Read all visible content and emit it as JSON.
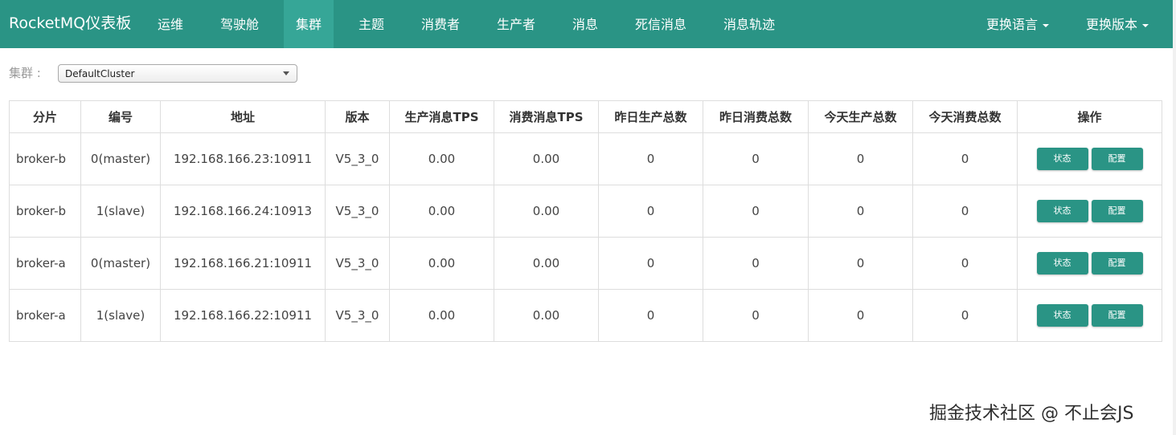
{
  "navbar": {
    "brand": "RocketMQ仪表板",
    "items": [
      "运维",
      "驾驶舱",
      "集群",
      "主题",
      "消费者",
      "生产者",
      "消息",
      "死信消息",
      "消息轨迹"
    ],
    "active": "集群",
    "language": "更换语言",
    "version": "更换版本",
    "color": "#2a9485"
  },
  "cluster": {
    "label": "集群 :",
    "selected": "DefaultCluster"
  },
  "table": {
    "headers": [
      "分片",
      "编号",
      "地址",
      "版本",
      "生产消息TPS",
      "消费消息TPS",
      "昨日生产总数",
      "昨日消费总数",
      "今天生产总数",
      "今天消费总数",
      "操作"
    ],
    "rows": [
      {
        "name": "broker-b",
        "id": "0(master)",
        "addr": "192.168.166.23:10911",
        "version": "V5_3_0",
        "in_tps": "0.00",
        "out_tps": "0.00",
        "yest_in": "0",
        "yest_out": "0",
        "today_in": "0",
        "today_out": "0"
      },
      {
        "name": "broker-b",
        "id": "1(slave)",
        "addr": "192.168.166.24:10913",
        "version": "V5_3_0",
        "in_tps": "0.00",
        "out_tps": "0.00",
        "yest_in": "0",
        "yest_out": "0",
        "today_in": "0",
        "today_out": "0"
      },
      {
        "name": "broker-a",
        "id": "0(master)",
        "addr": "192.168.166.21:10911",
        "version": "V5_3_0",
        "in_tps": "0.00",
        "out_tps": "0.00",
        "yest_in": "0",
        "yest_out": "0",
        "today_in": "0",
        "today_out": "0"
      },
      {
        "name": "broker-a",
        "id": "1(slave)",
        "addr": "192.168.166.22:10911",
        "version": "V5_3_0",
        "in_tps": "0.00",
        "out_tps": "0.00",
        "yest_in": "0",
        "yest_out": "0",
        "today_in": "0",
        "today_out": "0"
      }
    ],
    "status_btn": "状态",
    "config_btn": "配置"
  },
  "watermark": "掘金技术社区 @ 不止会JS"
}
